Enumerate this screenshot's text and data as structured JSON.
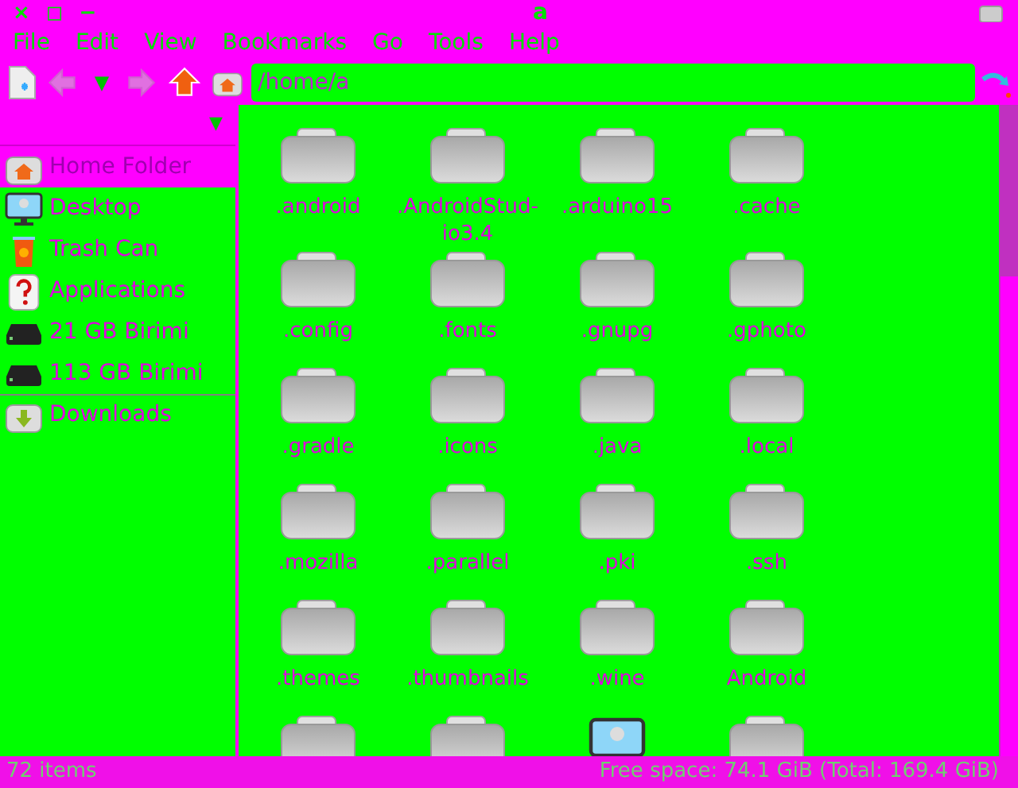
{
  "window": {
    "title": "a",
    "buttons": [
      "×",
      "◻",
      "−"
    ]
  },
  "menu": [
    "File",
    "Edit",
    "View",
    "Bookmarks",
    "Go",
    "Tools",
    "Help"
  ],
  "toolbar": {
    "back_disabled": true,
    "forward_disabled": true,
    "history_arrow": "▼",
    "path": "/home/a"
  },
  "sidebar": {
    "header_arrow": "▼",
    "items": [
      {
        "label": "Home Folder",
        "kind": "home",
        "selected": true,
        "divider_before": false
      },
      {
        "label": "Desktop",
        "kind": "desktop",
        "selected": false,
        "divider_before": false
      },
      {
        "label": "Trash Can",
        "kind": "trash",
        "selected": false,
        "divider_before": false
      },
      {
        "label": "Applications",
        "kind": "apps",
        "selected": false,
        "divider_before": false
      },
      {
        "label": "21 GB Birimi",
        "kind": "drive",
        "selected": false,
        "divider_before": false
      },
      {
        "label": "113 GB Birimi",
        "kind": "drive",
        "selected": false,
        "divider_before": false
      },
      {
        "label": "Downloads",
        "kind": "downloads",
        "selected": false,
        "divider_before": true
      }
    ]
  },
  "files": [
    {
      "name": ".android",
      "kind": "folder"
    },
    {
      "name": ".AndroidStud-io3.4",
      "kind": "folder"
    },
    {
      "name": ".arduino15",
      "kind": "folder"
    },
    {
      "name": ".cache",
      "kind": "folder"
    },
    {
      "name": ".config",
      "kind": "folder"
    },
    {
      "name": ".fonts",
      "kind": "folder"
    },
    {
      "name": ".gnupg",
      "kind": "folder"
    },
    {
      "name": ".gphoto",
      "kind": "folder"
    },
    {
      "name": ".gradle",
      "kind": "folder"
    },
    {
      "name": ".icons",
      "kind": "folder"
    },
    {
      "name": ".java",
      "kind": "folder"
    },
    {
      "name": ".local",
      "kind": "folder"
    },
    {
      "name": ".mozilla",
      "kind": "folder"
    },
    {
      "name": ".parallel",
      "kind": "folder"
    },
    {
      "name": ".pki",
      "kind": "folder"
    },
    {
      "name": ".ssh",
      "kind": "folder"
    },
    {
      "name": ".themes",
      "kind": "folder"
    },
    {
      "name": ".thumbnails",
      "kind": "folder"
    },
    {
      "name": ".wine",
      "kind": "folder"
    },
    {
      "name": "Android",
      "kind": "folder"
    },
    {
      "kind": "folder"
    },
    {
      "kind": "folder"
    },
    {
      "kind": "desktop"
    },
    {
      "kind": "folder"
    }
  ],
  "status_bar": {
    "count": "72 items",
    "free_space": "Free space: 74.1 GiB (Total: 169.4 GiB)"
  }
}
